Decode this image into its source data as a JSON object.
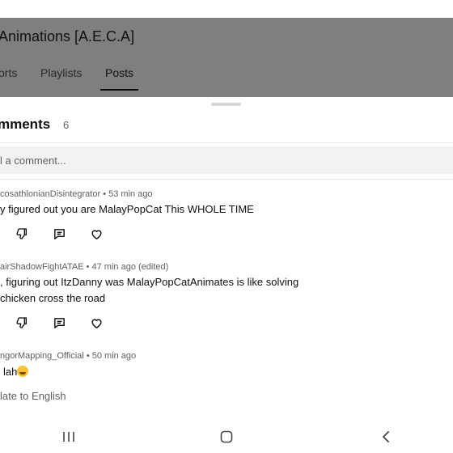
{
  "channel": {
    "title": "Animations [A.E.C.A]",
    "tabs": [
      {
        "label": "orts"
      },
      {
        "label": "Playlists"
      },
      {
        "label": "Posts",
        "active": true
      }
    ]
  },
  "comments_panel": {
    "title": "mments",
    "count": "6",
    "add_placeholder": "l a comment...",
    "comments": [
      {
        "author": "cosathlonianDisintegrator",
        "time": "53 min ago",
        "lines": [
          "y figured out you are MalayPopCat This WHOLE TIME"
        ]
      },
      {
        "author": "airShadowFightATAE",
        "time": "47 min ago (edited)",
        "lines": [
          ", figuring out ItzDanny was MalayPopCatAnimates is like solving",
          "chicken cross the road"
        ]
      },
      {
        "author": "ngorMapping_Official",
        "time": "50 min ago",
        "lines": [
          "lah"
        ],
        "emoji": "loudly-crying-face",
        "translate": "late to English"
      }
    ]
  },
  "icons": {
    "dislike": "thumb-down-icon",
    "reply": "reply-icon",
    "heart": "heart-icon",
    "nav_recents": "recents-icon",
    "nav_home": "home-icon",
    "nav_back": "back-icon"
  },
  "colors": {
    "header_overlay": "#7f7f7f",
    "input_bg": "#f2f2f2",
    "secondary_text": "#606060"
  }
}
